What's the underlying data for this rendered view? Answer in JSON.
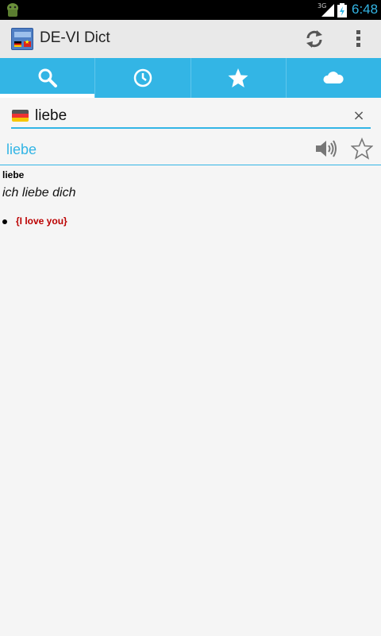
{
  "status_bar": {
    "network": "3G",
    "time": "6:48"
  },
  "action_bar": {
    "title": "DE-VI Dict",
    "actions": [
      "refresh-icon",
      "overflow-menu-icon"
    ]
  },
  "tabs": [
    {
      "icon": "search-icon",
      "active": true
    },
    {
      "icon": "history-clock-icon",
      "active": false
    },
    {
      "icon": "favorites-star-icon",
      "active": false
    },
    {
      "icon": "cloud-icon",
      "active": false
    }
  ],
  "search": {
    "language_flag": "de-flag-icon",
    "value": "liebe",
    "clear_label": "×"
  },
  "result": {
    "word": "liebe",
    "headword": "liebe",
    "example": "ich liebe dich",
    "translation": "{I love you}"
  },
  "colors": {
    "accent": "#33b5e5",
    "action_bar": "#e9e9e9",
    "translation": "#bb0000"
  }
}
